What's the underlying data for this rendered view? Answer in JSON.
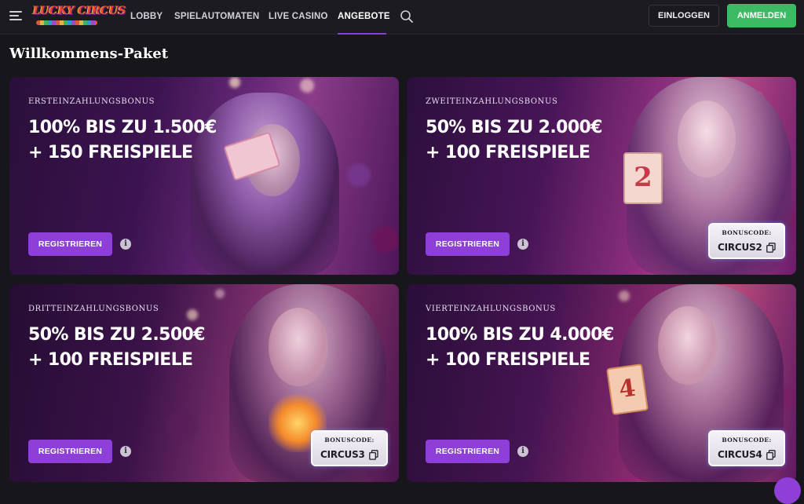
{
  "header": {
    "logo_text": "LUCKY CIRCUS",
    "nav": [
      {
        "label": "LOBBY"
      },
      {
        "label": "SPIELAUTOMATEN"
      },
      {
        "label": "LIVE CASINO"
      },
      {
        "label": "ANGEBOTE",
        "active": true
      }
    ],
    "login_label": "EINLOGGEN",
    "register_label": "ANMELDEN",
    "accent_color": "#8e3fd8",
    "register_color": "#3dbb63"
  },
  "page": {
    "title": "Willkommens-Paket"
  },
  "cards": [
    {
      "label": "ERSTEINZAHLUNGSBONUS",
      "line1": "100% BIS ZU 1.500€",
      "line2": "+ 150 FREISPIELE",
      "button": "REGISTRIEREN",
      "info": "i"
    },
    {
      "label": "ZWEITEINZAHLUNGSBONUS",
      "line1": "50% BIS ZU 2.000€",
      "line2": "+ 100 FREISPIELE",
      "button": "REGISTRIEREN",
      "info": "i",
      "code_label": "BONUSCODE:",
      "code": "CIRCUS2"
    },
    {
      "label": "DRITTEINZAHLUNGSBONUS",
      "line1": "50% BIS ZU 2.500€",
      "line2": "+ 100 FREISPIELE",
      "button": "REGISTRIEREN",
      "info": "i",
      "code_label": "BONUSCODE:",
      "code": "CIRCUS3"
    },
    {
      "label": "VIERTEINZAHLUNGSBONUS",
      "line1": "100% BIS ZU 4.000€",
      "line2": "+ 100 FREISPIELE",
      "button": "REGISTRIEREN",
      "info": "i",
      "code_label": "BONUSCODE:",
      "code": "CIRCUS4"
    }
  ]
}
